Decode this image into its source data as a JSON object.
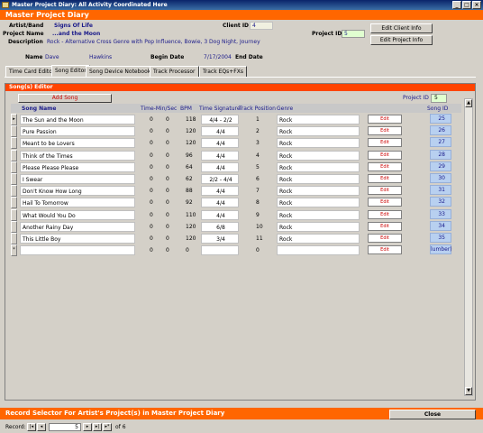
{
  "window": {
    "title": "Master Project Diary: All Activity Coordinated Here",
    "min": "_",
    "max": "□",
    "close": "×"
  },
  "header": {
    "title": "Master Project Diary"
  },
  "info": {
    "artist_label": "Artist/Band",
    "artist_value": "Signs Of Life",
    "project_name_label": "Project Name",
    "project_name_value": "...and the Moon",
    "description_label": "Description",
    "description_value": "Rock - Alternative Cross Genre with Pop Influence, Bowie, 3 Dog Night, Journey",
    "client_id_label": "Client ID",
    "client_id_value": "4",
    "project_id_label": "Project ID",
    "project_id_value": "5",
    "name_label": "Name",
    "first_name": "Dave",
    "last_name": "Hawkins",
    "begin_date_label": "Begin Date",
    "begin_date_value": "7/17/2004",
    "end_date_label": "End Date",
    "end_date_value": ""
  },
  "buttons": {
    "edit_client": "Edit Client Info",
    "edit_project": "Edit Project Info",
    "add_song": "Add Song",
    "close": "Close"
  },
  "tabs": [
    "Time Card Editor",
    "Song Editor",
    "Song Device Notebook",
    "Track Processor",
    "Track EQs+FXs"
  ],
  "subform": {
    "title": "Song(s) Editor",
    "project_id_label": "Project ID",
    "project_id_value": "5"
  },
  "columns": {
    "song_name": "Song Name",
    "time": "Time-Min/Sec",
    "bpm": "BPM",
    "sig": "Time Signature",
    "track": "Track Position",
    "genre": "Genre",
    "song_id": "Song ID"
  },
  "rows": [
    {
      "name": "The Sun and the Moon",
      "min": "0",
      "sec": "0",
      "bpm": "118",
      "sig": "4/4 - 2/2",
      "track": "1",
      "genre": "Rock",
      "edit": "Edit",
      "id": "25"
    },
    {
      "name": "Pure Passion",
      "min": "0",
      "sec": "0",
      "bpm": "120",
      "sig": "4/4",
      "track": "2",
      "genre": "Rock",
      "edit": "Edit",
      "id": "26"
    },
    {
      "name": "Meant to be Lovers",
      "min": "0",
      "sec": "0",
      "bpm": "120",
      "sig": "4/4",
      "track": "3",
      "genre": "Rock",
      "edit": "Edit",
      "id": "27"
    },
    {
      "name": "Think of the Times",
      "min": "0",
      "sec": "0",
      "bpm": "96",
      "sig": "4/4",
      "track": "4",
      "genre": "Rock",
      "edit": "Edit",
      "id": "28"
    },
    {
      "name": "Please Please Please",
      "min": "0",
      "sec": "0",
      "bpm": "64",
      "sig": "4/4",
      "track": "5",
      "genre": "Rock",
      "edit": "Edit",
      "id": "29"
    },
    {
      "name": "I Swear",
      "min": "0",
      "sec": "0",
      "bpm": "62",
      "sig": "2/2 - 4/4",
      "track": "6",
      "genre": "Rock",
      "edit": "Edit",
      "id": "30"
    },
    {
      "name": "Don't Know How Long",
      "min": "0",
      "sec": "0",
      "bpm": "88",
      "sig": "4/4",
      "track": "7",
      "genre": "Rock",
      "edit": "Edit",
      "id": "31"
    },
    {
      "name": "Hail To Tomorrow",
      "min": "0",
      "sec": "0",
      "bpm": "92",
      "sig": "4/4",
      "track": "8",
      "genre": "Rock",
      "edit": "Edit",
      "id": "32"
    },
    {
      "name": "What Would You Do",
      "min": "0",
      "sec": "0",
      "bpm": "110",
      "sig": "4/4",
      "track": "9",
      "genre": "Rock",
      "edit": "Edit",
      "id": "33"
    },
    {
      "name": "Another Rainy Day",
      "min": "0",
      "sec": "0",
      "bpm": "120",
      "sig": "6/8",
      "track": "10",
      "genre": "Rock",
      "edit": "Edit",
      "id": "34"
    },
    {
      "name": "This Little Boy",
      "min": "0",
      "sec": "0",
      "bpm": "120",
      "sig": "3/4",
      "track": "11",
      "genre": "Rock",
      "edit": "Edit",
      "id": "35"
    },
    {
      "name": "",
      "min": "0",
      "sec": "0",
      "bpm": "0",
      "sig": "",
      "track": "0",
      "genre": "",
      "edit": "Edit",
      "id": "lumber)"
    }
  ],
  "row_markers": {
    "current": "▸",
    "new": "*"
  },
  "footer": {
    "text": "Record Selector For Artist's Project(s) in  Master Project Diary"
  },
  "nav": {
    "label": "Record:",
    "first": "|◂",
    "prev": "◂",
    "current": "5",
    "next": "▸",
    "last": "▸|",
    "new": "▸*",
    "of_text": "of 6"
  }
}
